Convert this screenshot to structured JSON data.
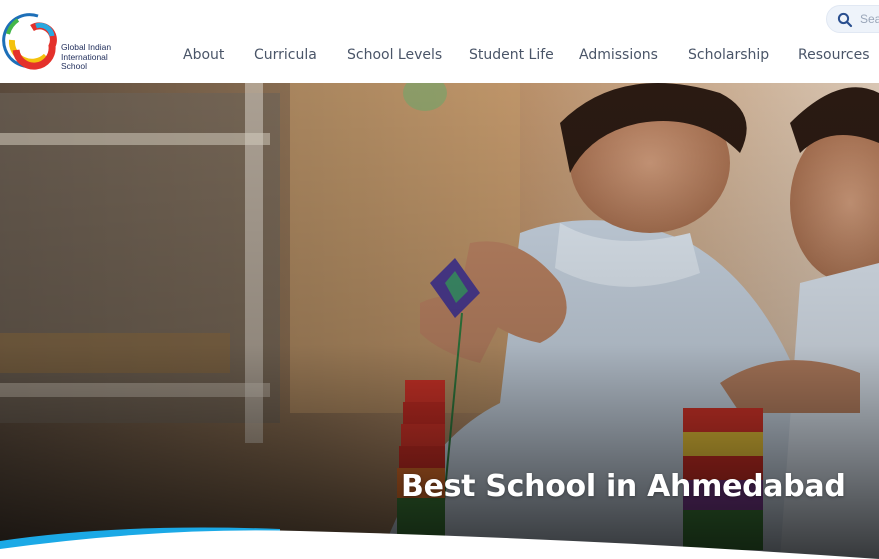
{
  "brand": {
    "logo_lines": [
      "Global Indian",
      "International",
      "School"
    ]
  },
  "search": {
    "placeholder": "Search"
  },
  "nav": {
    "items": [
      "About",
      "Curricula",
      "School Levels",
      "Student Life",
      "Admissions",
      "Scholarship",
      "Resources"
    ]
  },
  "hero": {
    "title": "Best School in Ahmedabad"
  },
  "colors": {
    "nav_text": "#4a5568",
    "logo_text": "#24315e",
    "wave_blue": "#1ba9e6",
    "search_bg": "#eef3fa"
  }
}
